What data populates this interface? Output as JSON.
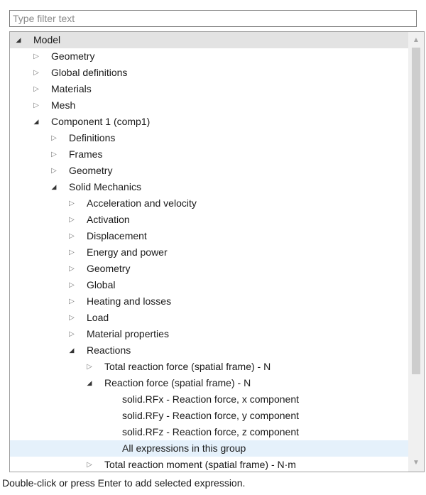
{
  "filter": {
    "placeholder": "Type filter text",
    "value": ""
  },
  "tree": [
    {
      "label": "Model",
      "level": 0,
      "state": "expanded",
      "header": true
    },
    {
      "label": "Geometry",
      "level": 1,
      "state": "collapsed"
    },
    {
      "label": "Global definitions",
      "level": 1,
      "state": "collapsed"
    },
    {
      "label": "Materials",
      "level": 1,
      "state": "collapsed"
    },
    {
      "label": "Mesh",
      "level": 1,
      "state": "collapsed"
    },
    {
      "label": "Component 1 (comp1)",
      "level": 1,
      "state": "expanded"
    },
    {
      "label": "Definitions",
      "level": 2,
      "state": "collapsed"
    },
    {
      "label": "Frames",
      "level": 2,
      "state": "collapsed"
    },
    {
      "label": "Geometry",
      "level": 2,
      "state": "collapsed"
    },
    {
      "label": "Solid Mechanics",
      "level": 2,
      "state": "expanded"
    },
    {
      "label": "Acceleration and velocity",
      "level": 3,
      "state": "collapsed"
    },
    {
      "label": "Activation",
      "level": 3,
      "state": "collapsed"
    },
    {
      "label": "Displacement",
      "level": 3,
      "state": "collapsed"
    },
    {
      "label": "Energy and power",
      "level": 3,
      "state": "collapsed"
    },
    {
      "label": "Geometry",
      "level": 3,
      "state": "collapsed"
    },
    {
      "label": "Global",
      "level": 3,
      "state": "collapsed"
    },
    {
      "label": "Heating and losses",
      "level": 3,
      "state": "collapsed"
    },
    {
      "label": "Load",
      "level": 3,
      "state": "collapsed"
    },
    {
      "label": "Material properties",
      "level": 3,
      "state": "collapsed"
    },
    {
      "label": "Reactions",
      "level": 3,
      "state": "expanded"
    },
    {
      "label": "Total reaction force (spatial frame) - N",
      "level": 4,
      "state": "collapsed"
    },
    {
      "label": "Reaction force (spatial frame) - N",
      "level": 4,
      "state": "expanded"
    },
    {
      "label": "solid.RFx - Reaction force, x component",
      "level": 5,
      "state": "leaf"
    },
    {
      "label": "solid.RFy - Reaction force, y component",
      "level": 5,
      "state": "leaf"
    },
    {
      "label": "solid.RFz - Reaction force, z component",
      "level": 5,
      "state": "leaf"
    },
    {
      "label": "All expressions in this group",
      "level": 5,
      "state": "leaf",
      "selected": true
    },
    {
      "label": "Total reaction moment (spatial frame) - N·m",
      "level": 4,
      "state": "collapsed"
    }
  ],
  "status": {
    "text": "Double-click or press Enter to add selected expression."
  },
  "icons": {
    "collapsed": "triangle-right-icon",
    "expanded": "triangle-down-icon"
  },
  "colors": {
    "selected_row": "#e5f1fb",
    "header_row": "#e3e3e3"
  }
}
